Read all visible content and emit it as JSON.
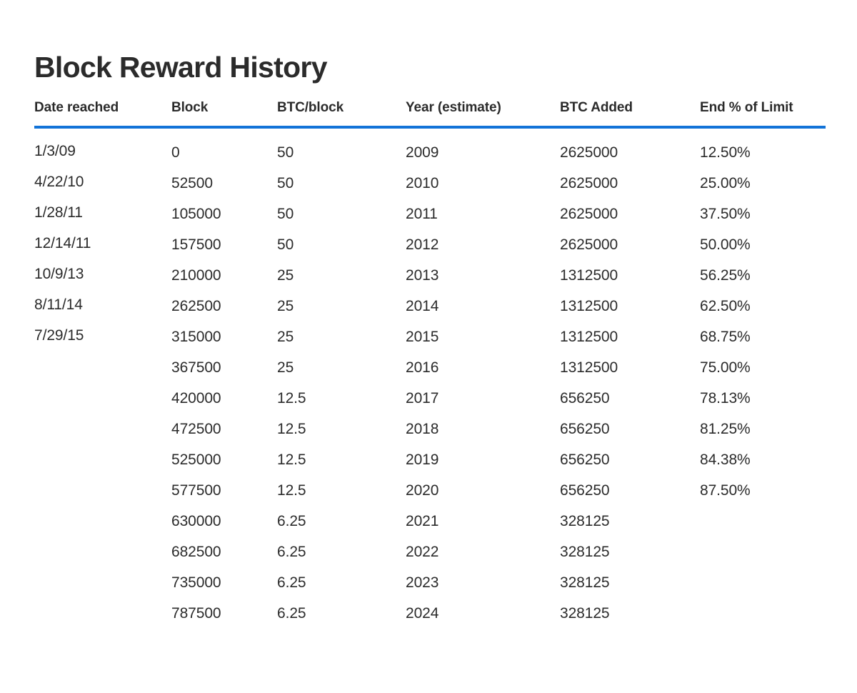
{
  "page": {
    "title": "Block Reward History",
    "accent_color": "#1273d8",
    "text_color": "#2b2b2b",
    "background_color": "#ffffff"
  },
  "table": {
    "columns": [
      {
        "key": "date_reached",
        "label": "Date reached"
      },
      {
        "key": "block",
        "label": "Block"
      },
      {
        "key": "btc_per_block",
        "label": "BTC/block"
      },
      {
        "key": "year_estimate",
        "label": "Year (estimate)"
      },
      {
        "key": "btc_added",
        "label": "BTC Added"
      },
      {
        "key": "end_pct_of_limit",
        "label": "End % of Limit"
      }
    ],
    "rows": [
      {
        "date_reached": "1/3/09",
        "block": "0",
        "btc_per_block": "50",
        "year_estimate": "2009",
        "btc_added": "2625000",
        "end_pct_of_limit": "12.50%"
      },
      {
        "date_reached": "4/22/10",
        "block": "52500",
        "btc_per_block": "50",
        "year_estimate": "2010",
        "btc_added": "2625000",
        "end_pct_of_limit": "25.00%"
      },
      {
        "date_reached": "1/28/11",
        "block": "105000",
        "btc_per_block": "50",
        "year_estimate": "2011",
        "btc_added": "2625000",
        "end_pct_of_limit": "37.50%"
      },
      {
        "date_reached": "12/14/11",
        "block": "157500",
        "btc_per_block": "50",
        "year_estimate": "2012",
        "btc_added": "2625000",
        "end_pct_of_limit": "50.00%"
      },
      {
        "date_reached": "10/9/13",
        "block": "210000",
        "btc_per_block": "25",
        "year_estimate": "2013",
        "btc_added": "1312500",
        "end_pct_of_limit": "56.25%"
      },
      {
        "date_reached": "8/11/14",
        "block": "262500",
        "btc_per_block": "25",
        "year_estimate": "2014",
        "btc_added": "1312500",
        "end_pct_of_limit": "62.50%"
      },
      {
        "date_reached": "7/29/15",
        "block": "315000",
        "btc_per_block": "25",
        "year_estimate": "2015",
        "btc_added": "1312500",
        "end_pct_of_limit": "68.75%"
      },
      {
        "date_reached": "",
        "block": "367500",
        "btc_per_block": "25",
        "year_estimate": "2016",
        "btc_added": "1312500",
        "end_pct_of_limit": "75.00%"
      },
      {
        "date_reached": "",
        "block": "420000",
        "btc_per_block": "12.5",
        "year_estimate": "2017",
        "btc_added": "656250",
        "end_pct_of_limit": "78.13%"
      },
      {
        "date_reached": "",
        "block": "472500",
        "btc_per_block": "12.5",
        "year_estimate": "2018",
        "btc_added": "656250",
        "end_pct_of_limit": "81.25%"
      },
      {
        "date_reached": "",
        "block": "525000",
        "btc_per_block": "12.5",
        "year_estimate": "2019",
        "btc_added": "656250",
        "end_pct_of_limit": "84.38%"
      },
      {
        "date_reached": "",
        "block": "577500",
        "btc_per_block": "12.5",
        "year_estimate": "2020",
        "btc_added": "656250",
        "end_pct_of_limit": "87.50%"
      },
      {
        "date_reached": "",
        "block": "630000",
        "btc_per_block": "6.25",
        "year_estimate": "2021",
        "btc_added": "328125",
        "end_pct_of_limit": ""
      },
      {
        "date_reached": "",
        "block": "682500",
        "btc_per_block": "6.25",
        "year_estimate": "2022",
        "btc_added": "328125",
        "end_pct_of_limit": ""
      },
      {
        "date_reached": "",
        "block": "735000",
        "btc_per_block": "6.25",
        "year_estimate": "2023",
        "btc_added": "328125",
        "end_pct_of_limit": ""
      },
      {
        "date_reached": "",
        "block": "787500",
        "btc_per_block": "6.25",
        "year_estimate": "2024",
        "btc_added": "328125",
        "end_pct_of_limit": ""
      }
    ]
  }
}
